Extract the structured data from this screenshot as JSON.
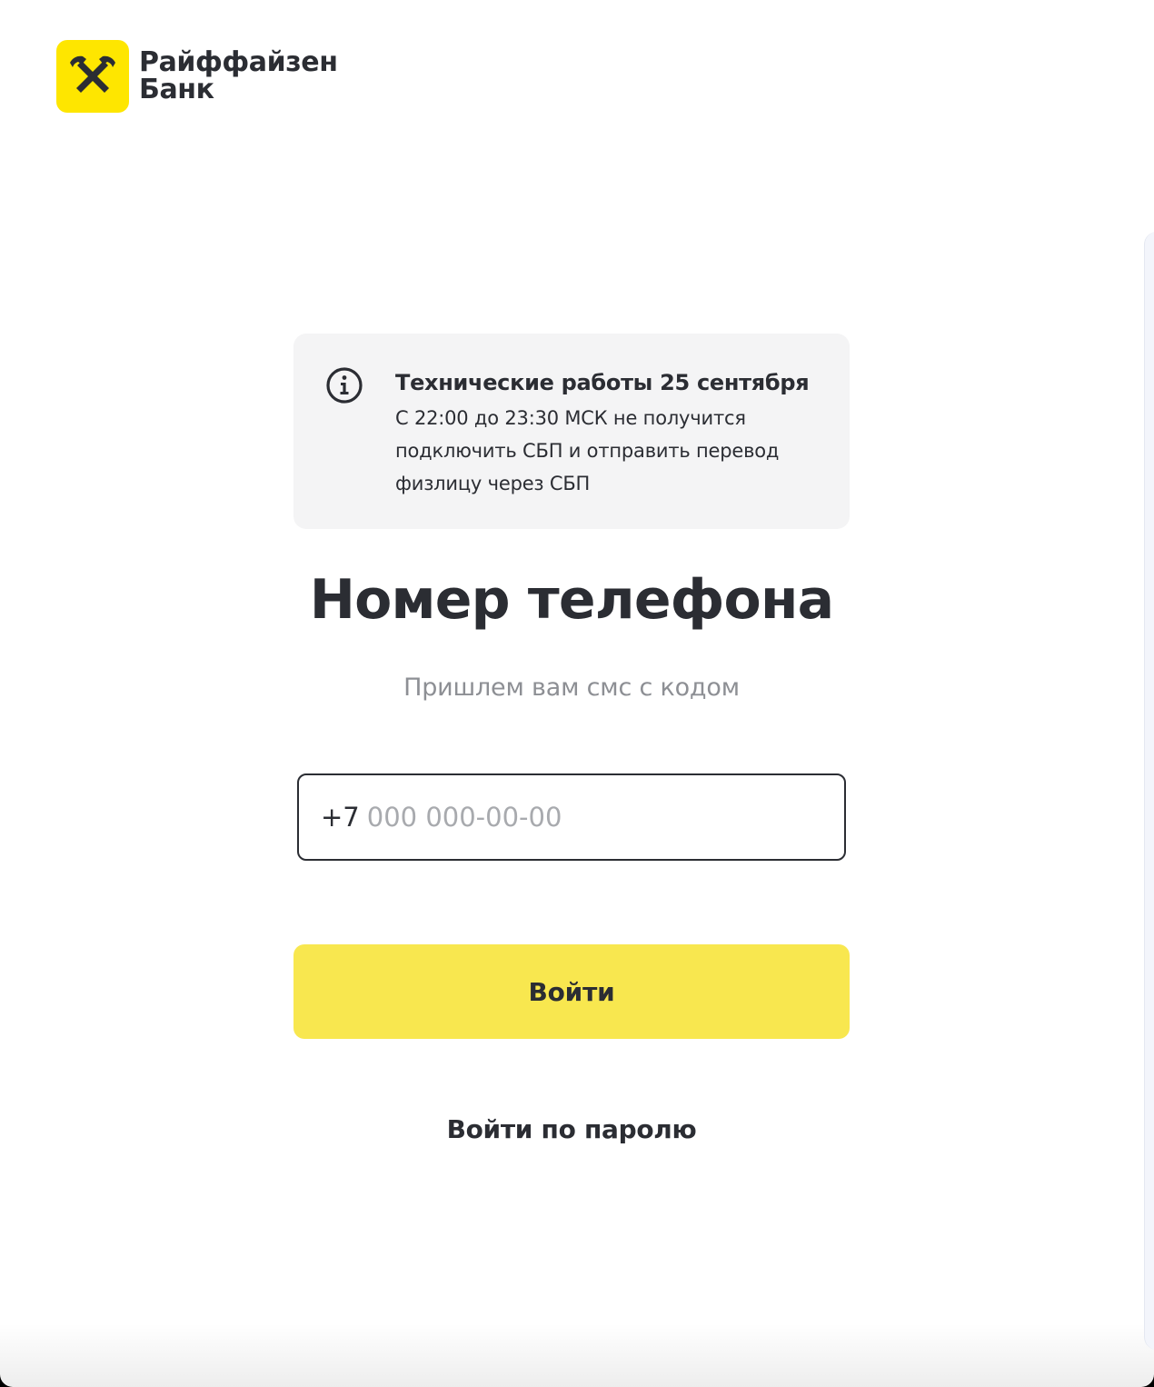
{
  "brand": {
    "name_line1": "Райффайзен",
    "name_line2": "Банк",
    "logo_icon": "raiffeisen-crossed-horses-icon",
    "accent_color": "#fee600"
  },
  "notice": {
    "icon": "info-icon",
    "title": "Технические работы 25 сентября",
    "text": "С 22:00 до 23:30 МСК не получится подключить СБП и отправить перевод физлицу через СБП"
  },
  "login": {
    "title": "Номер телефона",
    "subtitle": "Пришлем вам смс с кодом",
    "phone_prefix": "+7",
    "phone_placeholder": "000 000-00-00",
    "phone_value": "",
    "submit_label": "Войти",
    "submit_color": "#f8e74f",
    "password_link": "Войти по паролю"
  }
}
